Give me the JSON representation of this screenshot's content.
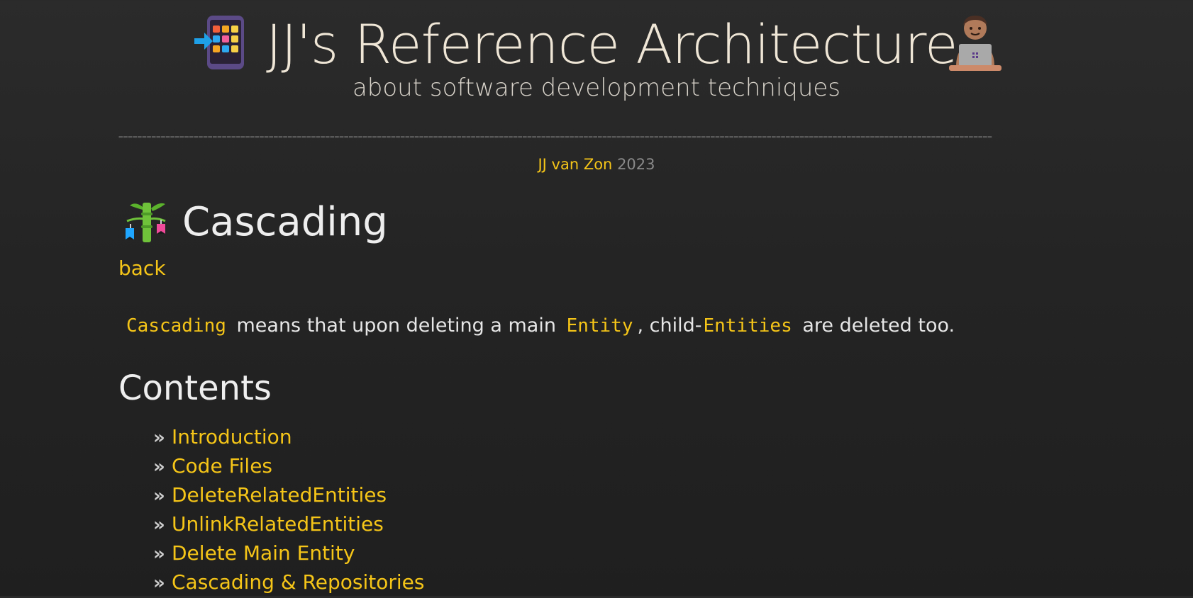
{
  "header": {
    "title": "JJ's Reference Architecture",
    "subtitle": "about software development techniques",
    "left_icon": "mobile-phone-with-arrow-icon",
    "right_icon": "technologist-at-laptop-icon",
    "divider": "=========================================================================================================================================================================================="
  },
  "byline": {
    "author": "JJ van Zon",
    "year": "2023"
  },
  "page": {
    "icon": "bamboo-decoration-icon",
    "title": "Cascading",
    "back_label": "back",
    "intro": {
      "term": "Cascading",
      "text1": "means that upon deleting a main",
      "entity": "Entity",
      "text2": ", child-",
      "entities": "Entities",
      "text3": "are deleted too."
    }
  },
  "contents": {
    "heading": "Contents",
    "bullet": "»",
    "items": [
      "Introduction",
      "Code Files",
      "DeleteRelatedEntities",
      "UnlinkRelatedEntities",
      "Delete Main Entity",
      "Cascading & Repositories"
    ]
  },
  "colors": {
    "accent": "#f5c518",
    "background": "#252525",
    "text": "#e6e6e6",
    "muted": "#8a8a8a"
  }
}
